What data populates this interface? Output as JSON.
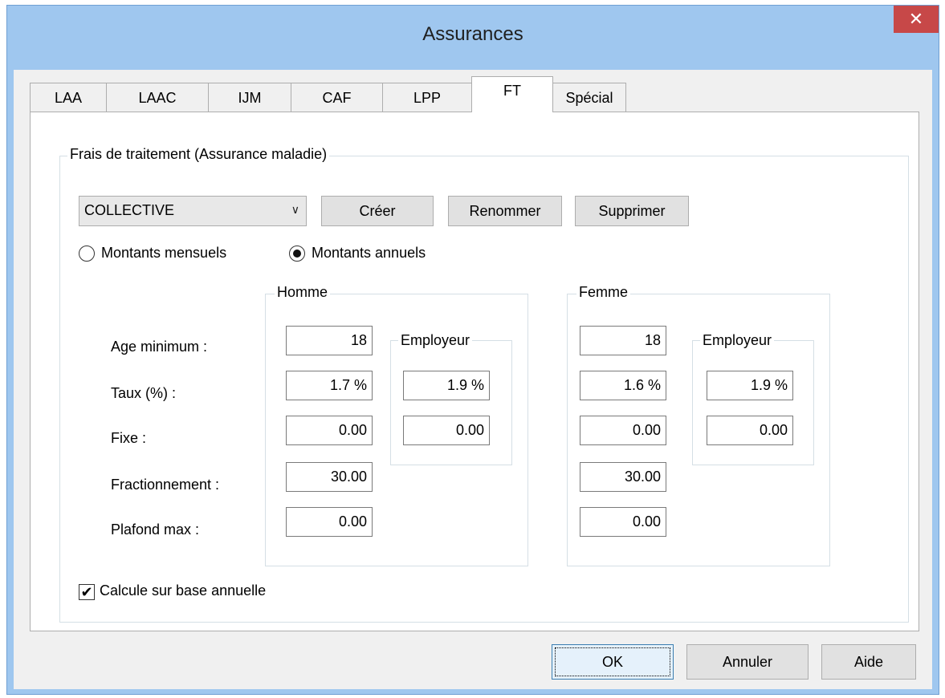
{
  "window": {
    "title": "Assurances",
    "close_glyph": "✕"
  },
  "tabs": [
    {
      "label": "LAA"
    },
    {
      "label": "LAAC"
    },
    {
      "label": "IJM"
    },
    {
      "label": "CAF"
    },
    {
      "label": "LPP"
    },
    {
      "label": "FT"
    },
    {
      "label": "Spécial"
    }
  ],
  "active_tab": "FT",
  "group": {
    "title": "Frais de traitement (Assurance maladie)"
  },
  "plan_select": {
    "value": "COLLECTIVE"
  },
  "actions": {
    "create": "Créer",
    "rename": "Renommer",
    "delete": "Supprimer"
  },
  "amount_mode": {
    "monthly": "Montants mensuels",
    "annual": "Montants annuels",
    "selected": "annual"
  },
  "rows": {
    "age_min": "Age minimum :",
    "rate": "Taux (%) :",
    "fixed": "Fixe :",
    "split": "Fractionnement :",
    "ceiling": "Plafond max :"
  },
  "homme": {
    "title": "Homme",
    "age_min": "18",
    "rate": "1.7 %",
    "fixed": "0.00",
    "split": "30.00",
    "ceiling": "0.00",
    "employer": {
      "title": "Employeur",
      "rate": "1.9 %",
      "fixed": "0.00"
    }
  },
  "femme": {
    "title": "Femme",
    "age_min": "18",
    "rate": "1.6 %",
    "fixed": "0.00",
    "split": "30.00",
    "ceiling": "0.00",
    "employer": {
      "title": "Employeur",
      "rate": "1.9 %",
      "fixed": "0.00"
    }
  },
  "annual_base": {
    "label": "Calcule sur base annuelle",
    "checked": true,
    "mark": "✔"
  },
  "footer": {
    "ok": "OK",
    "cancel": "Annuler",
    "help": "Aide"
  }
}
